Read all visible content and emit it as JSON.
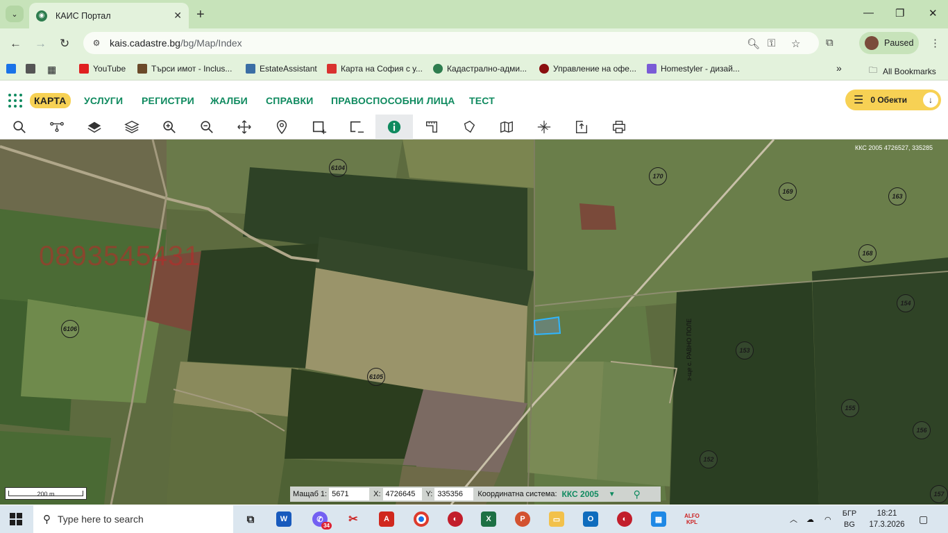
{
  "browser": {
    "tab_title": "КАИС Портал",
    "url_host": "kais.cadastre.bg",
    "url_path": "/bg/Map/Index",
    "profile_label": "Paused",
    "bookmarks": [
      {
        "label": "YouTube",
        "color": "#e02020"
      },
      {
        "label": "Търси имот - Inclus...",
        "color": "#6b4a2a"
      },
      {
        "label": "EstateAssistant",
        "color": "#3a6ea5"
      },
      {
        "label": "Карта на София с у...",
        "color": "#d9322f"
      },
      {
        "label": "Кадастрално-адми...",
        "color": "#2e7d4f"
      },
      {
        "label": "Управление на офе...",
        "color": "#8a0f0f"
      },
      {
        "label": "Homestyler - дизай...",
        "color": "#7a5cd6"
      }
    ],
    "all_bookmarks": "All Bookmarks",
    "more_bookmarks": "»"
  },
  "app": {
    "nav": [
      "КАРТА",
      "УСЛУГИ",
      "РЕГИСТРИ",
      "ЖАЛБИ",
      "СПРАВКИ",
      "ПРАВОСПОСОБНИ ЛИЦА",
      "ТЕСТ"
    ],
    "objects_label": "0 Обекти",
    "accent": "#0f8a5f",
    "highlight": "#f7d154"
  },
  "map": {
    "top_coords": "ККС 2005 4726527, 335285",
    "watermark": "0893545431",
    "parcels": [
      "6104",
      "170",
      "169",
      "163",
      "168",
      "6106",
      "154",
      "153",
      "6105",
      "155",
      "156",
      "152",
      "157"
    ],
    "road_label": "з-ще с. РАВНО ПОЛЕ",
    "scale_label": "200 m",
    "coords": {
      "scale_label": "Мащаб 1:",
      "scale_value": "5671",
      "x_label": "X:",
      "x_value": "4726645",
      "y_label": "Y:",
      "y_value": "335356",
      "system_label": "Координатна система:",
      "system_value": "ККС 2005"
    }
  },
  "taskbar": {
    "search_placeholder": "Type here to search",
    "viber_badge": "34",
    "lang_top": "БГР",
    "lang_bottom": "BG",
    "time": "18:21",
    "date": "17.3.2026 г.",
    "alfa_label": "ALFO KPL"
  }
}
